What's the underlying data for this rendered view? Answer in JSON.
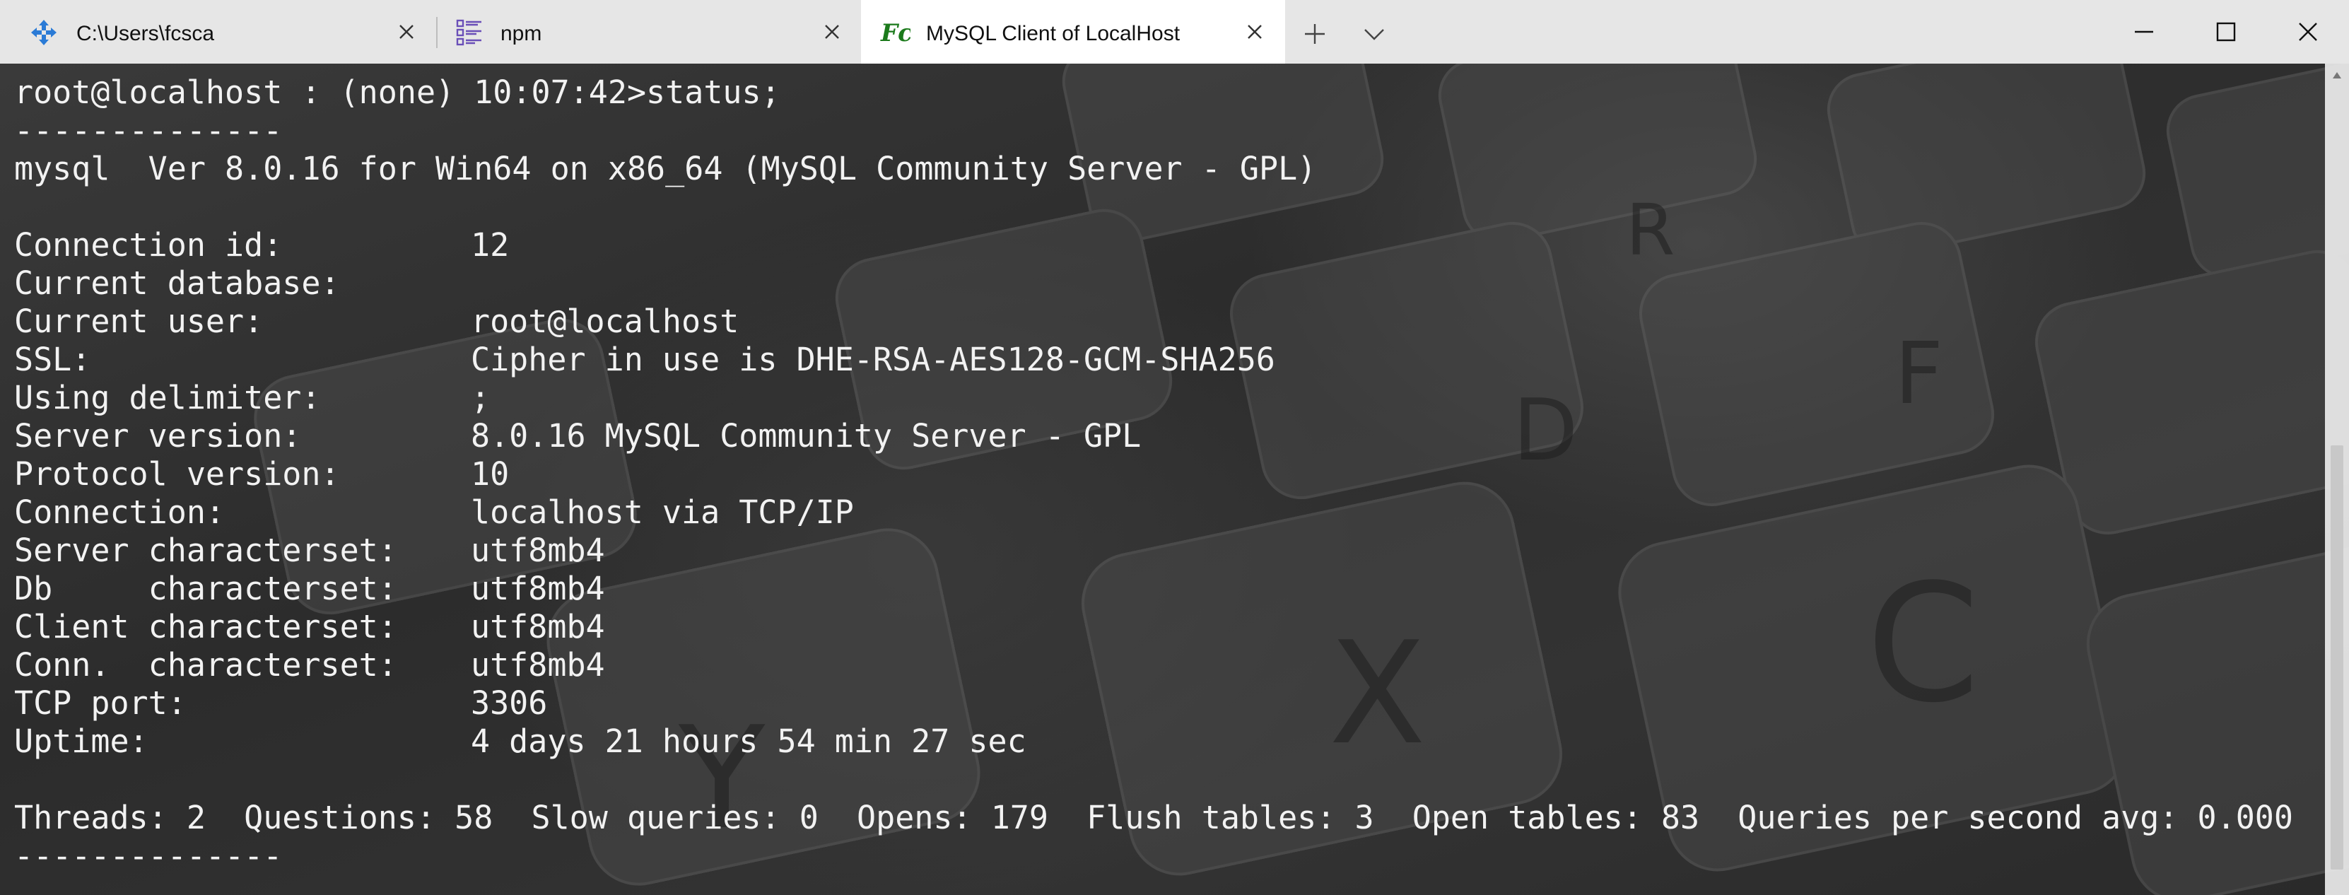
{
  "tabs": [
    {
      "label": "C:\\Users\\fcsca",
      "icon": "move-arrows-icon",
      "active": false
    },
    {
      "label": "npm",
      "icon": "list-icon",
      "active": false
    },
    {
      "label": "MySQL Client of LocalHost",
      "icon": "fc-logo-icon",
      "active": true
    }
  ],
  "colors": {
    "titlebar_bg": "#e6e6e6",
    "active_tab_bg": "#ffffff",
    "terminal_text": "#f2f2f2",
    "fc_icon": "#1b7a1b",
    "tab1_icon": "#2b7bd6",
    "tab2_icon": "#6a4fb8"
  },
  "window_controls": {
    "minimize": "minimize-icon",
    "maximize": "maximize-icon",
    "close": "close-icon"
  },
  "terminal": {
    "prompt": "root@localhost : (none) 10:07:42>status;",
    "separator_top": "--------------",
    "version_line": "mysql  Ver 8.0.16 for Win64 on x86_64 (MySQL Community Server - GPL)",
    "status": [
      {
        "key": "Connection id:",
        "value": "12"
      },
      {
        "key": "Current database:",
        "value": ""
      },
      {
        "key": "Current user:",
        "value": "root@localhost"
      },
      {
        "key": "SSL:",
        "value": "Cipher in use is DHE-RSA-AES128-GCM-SHA256"
      },
      {
        "key": "Using delimiter:",
        "value": ";"
      },
      {
        "key": "Server version:",
        "value": "8.0.16 MySQL Community Server - GPL"
      },
      {
        "key": "Protocol version:",
        "value": "10"
      },
      {
        "key": "Connection:",
        "value": "localhost via TCP/IP"
      },
      {
        "key": "Server characterset:",
        "value": "utf8mb4"
      },
      {
        "key": "Db     characterset:",
        "value": "utf8mb4"
      },
      {
        "key": "Client characterset:",
        "value": "utf8mb4"
      },
      {
        "key": "Conn.  characterset:",
        "value": "utf8mb4"
      },
      {
        "key": "TCP port:",
        "value": "3306"
      },
      {
        "key": "Uptime:",
        "value": "4 days 21 hours 54 min 27 sec"
      }
    ],
    "summary_line": "Threads: 2  Questions: 58  Slow queries: 0  Opens: 179  Flush tables: 3  Open tables: 83  Queries per second avg: 0.000",
    "separator_bottom": "--------------"
  }
}
